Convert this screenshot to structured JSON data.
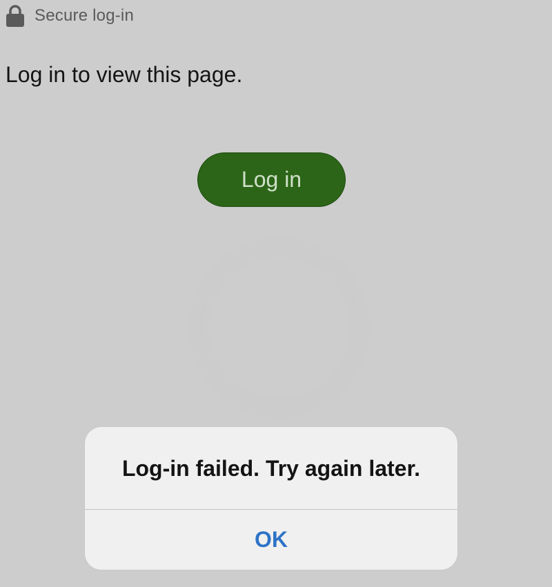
{
  "header": {
    "icon": "lock-icon",
    "label": "Secure log-in"
  },
  "content": {
    "message": "Log in to view this page.",
    "login_button_label": "Log in"
  },
  "alert": {
    "message": "Log-in failed. Try again later.",
    "ok_label": "OK"
  },
  "colors": {
    "background": "#cdcdcd",
    "button": "#2c6518",
    "dialog": "#f0f0f0",
    "link": "#2e74c7"
  }
}
